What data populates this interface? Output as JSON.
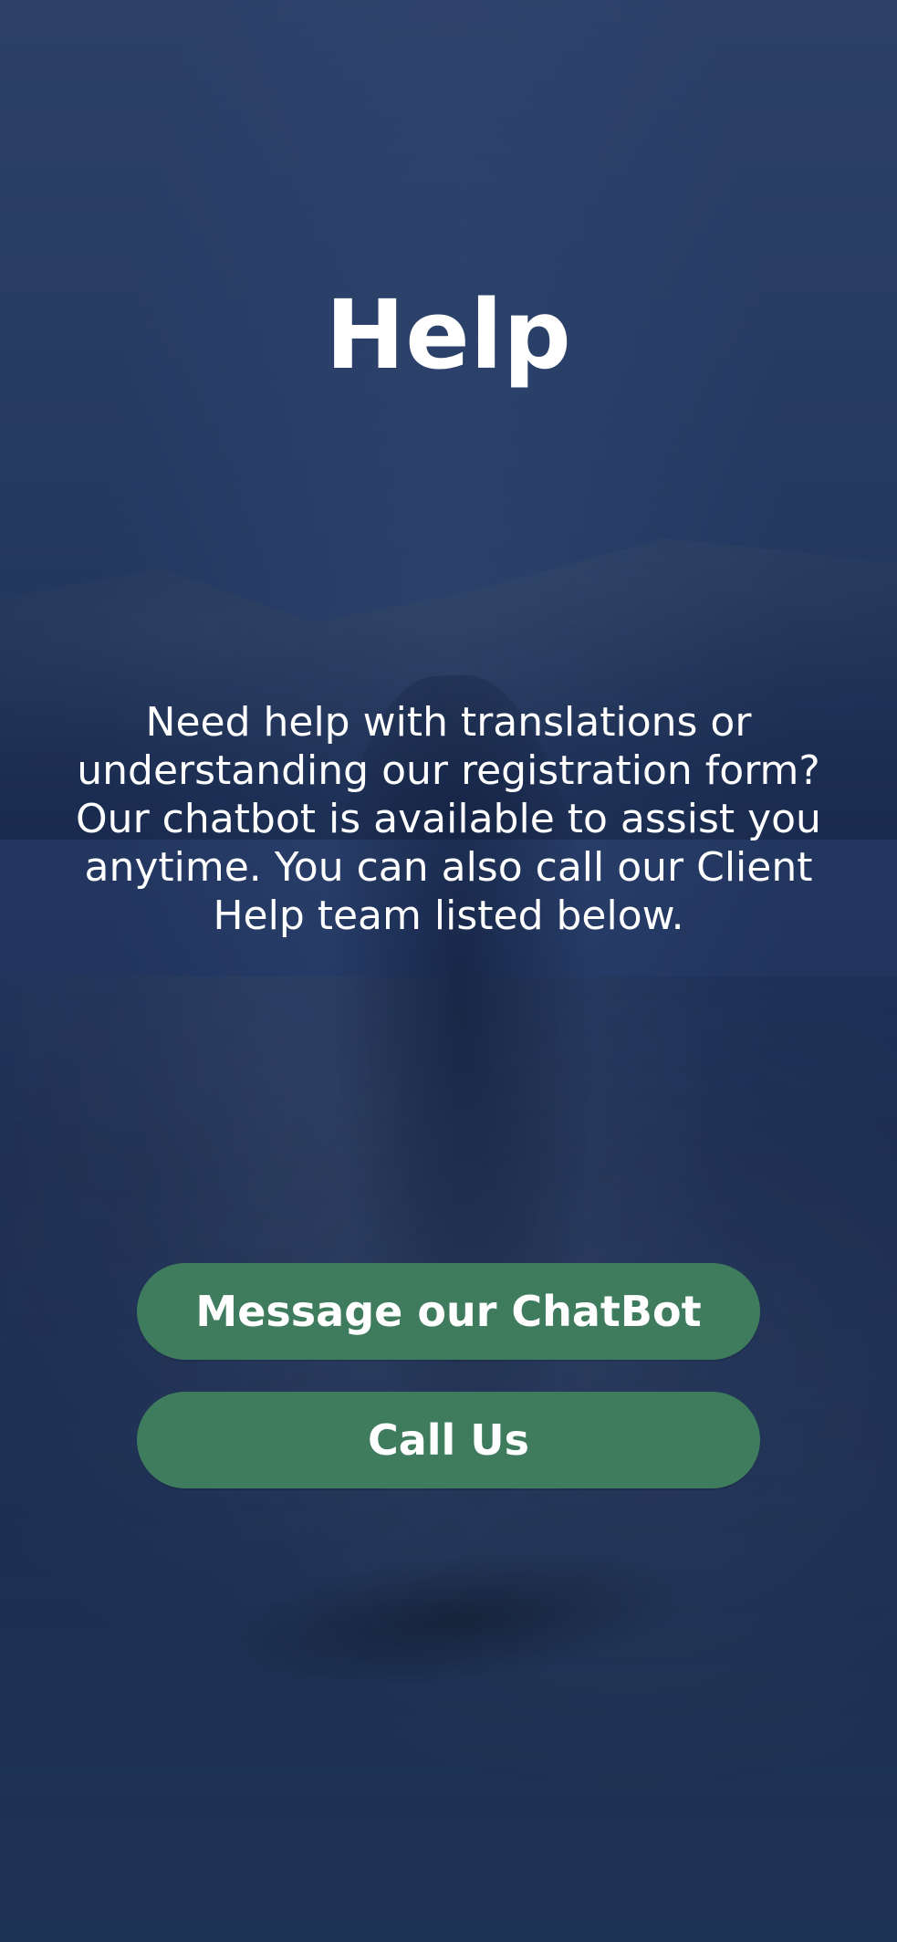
{
  "title": "Help",
  "description": "Need help with translations or understanding our registration form? Our chatbot is available to assist you anytime. You can also call our Client Help team listed below.",
  "actions": {
    "chat_label": "Message our ChatBot",
    "call_label": "Call Us"
  },
  "colors": {
    "overlay": "#1f3560",
    "button": "#3f7c5e",
    "text": "#ffffff"
  }
}
